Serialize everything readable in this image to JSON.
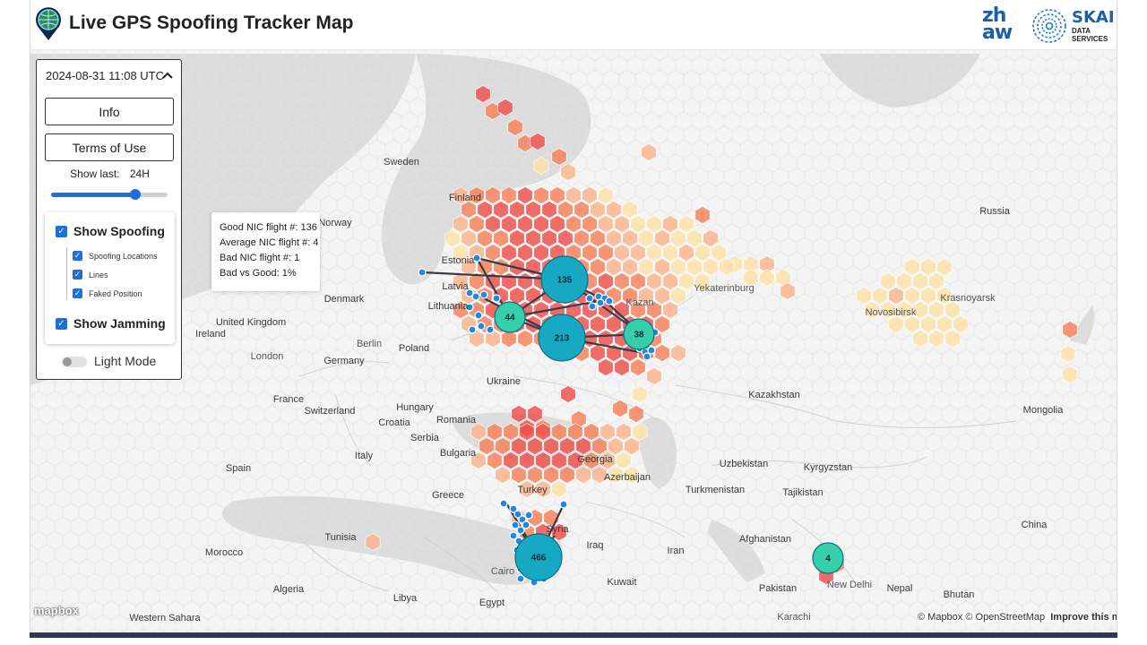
{
  "header": {
    "title": "Live GPS Spoofing Tracker Map",
    "zhaw_logo_text": [
      "zh",
      "aw"
    ],
    "skai_name": "SKAI",
    "skai_subtitle": "DATA\nSERVICES"
  },
  "panel": {
    "datetime": "2024-08-31 11:08 UTC",
    "info_label": "Info",
    "terms_label": "Terms of Use",
    "show_last_label": "Show last:",
    "show_last_value": "24H",
    "slider_fraction": 0.72,
    "show_spoofing_label": "Show Spoofing",
    "show_spoofing_checked": true,
    "spoofing_locations_label": "Spoofing Locations",
    "lines_label": "Lines",
    "faked_position_label": "Faked Position",
    "show_jamming_label": "Show Jamming",
    "show_jamming_checked": true,
    "light_mode_label": "Light Mode",
    "light_mode_on": false
  },
  "tooltip": {
    "lines": [
      "Good NIC flight #: 136",
      "Average NIC flight #: 4",
      "Bad NIC flight #: 1",
      "Bad vs Good: 1%"
    ]
  },
  "clusters": [
    {
      "count": "135",
      "color": "#17a9c4"
    },
    {
      "count": "44",
      "color": "#35cfa9"
    },
    {
      "count": "213",
      "color": "#17a9c4"
    },
    {
      "count": "38",
      "color": "#35cfa9"
    },
    {
      "count": "466",
      "color": "#17a9c4"
    },
    {
      "count": "4",
      "color": "#35cfa9"
    }
  ],
  "places": {
    "countries": [
      "Sweden",
      "Finland",
      "Norway",
      "Estonia",
      "Latvia",
      "Lithuania",
      "Denmark",
      "United Kingdom",
      "Ireland",
      "Poland",
      "Germany",
      "France",
      "Switzerland",
      "Italy",
      "Spain",
      "Croatia",
      "Serbia",
      "Hungary",
      "Romania",
      "Bulgaria",
      "Greece",
      "Turkey",
      "Ukraine",
      "Russia",
      "Kazakhstan",
      "Mongolia",
      "China",
      "Uzbekistan",
      "Turkmenistan",
      "Kyrgyzstan",
      "Tajikistan",
      "Afghanistan",
      "Pakistan",
      "Iran",
      "Iraq",
      "Syria",
      "Kuwait",
      "Libya",
      "Egypt",
      "Algeria",
      "Morocco",
      "Tunisia",
      "Nepal",
      "Bhutan",
      "Georgia",
      "Azerbaijan",
      "Western Sahara"
    ],
    "cities": [
      "Berlin",
      "London",
      "Yekaterinburg",
      "Novosibirsk",
      "Krasnoyarsk",
      "Kazan",
      "Cairo",
      "Karachi",
      "New Delhi"
    ]
  },
  "colors": {
    "spoof_point": "#1e88e5",
    "hex_severe": "#ef5350",
    "hex_high": "#f4845f",
    "hex_medium": "#f9b58f",
    "hex_low": "#fbe2a8",
    "accent": "#1e6fd9"
  },
  "attribution": {
    "text": "© Mapbox © OpenStreetMap",
    "improve": "Improve this map",
    "mapbox_logo": "mapbox"
  }
}
